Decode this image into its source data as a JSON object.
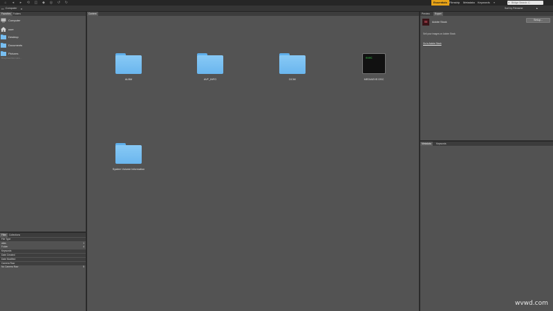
{
  "workspaces": [
    {
      "label": "Essentials",
      "active": true
    },
    {
      "label": "Filmstrip"
    },
    {
      "label": "Metadata"
    },
    {
      "label": "Keywords"
    }
  ],
  "search": {
    "placeholder": "Bridge Search: C"
  },
  "path": {
    "crumb": "Computer",
    "sort_label": "Sort by Filename"
  },
  "left_top_tabs": [
    "Favorites",
    "Folders"
  ],
  "favorites": [
    {
      "label": "Computer",
      "icon": "computer-icon"
    },
    {
      "label": "user",
      "icon": "home-icon"
    },
    {
      "label": "Desktop",
      "icon": "folder-icon"
    },
    {
      "label": "Documents",
      "icon": "folder-icon"
    },
    {
      "label": "Pictures",
      "icon": "folder-icon"
    }
  ],
  "favorites_hint": "Drag Favorites Here...",
  "left_bottom_tabs": [
    "Filter",
    "Collections"
  ],
  "filters": [
    {
      "label": "File Type",
      "header": true
    },
    {
      "label": "alias",
      "count": "1"
    },
    {
      "label": "Folder",
      "count": "4"
    },
    {
      "label": "Keywords",
      "header": true
    },
    {
      "label": "Date Created",
      "header": true
    },
    {
      "label": "Date Modified",
      "header": true
    },
    {
      "label": "Camera Raw",
      "header": true
    },
    {
      "label": "No Camera Raw",
      "count": "5"
    }
  ],
  "content_tab": "Content",
  "items": [
    {
      "label": "ALBM",
      "kind": "folder"
    },
    {
      "label": "AVF_INFO",
      "kind": "folder"
    },
    {
      "label": "DCIM",
      "kind": "folder"
    },
    {
      "label": "MEDIAEXE.DSC",
      "kind": "exec",
      "badge": "exec"
    },
    {
      "label": "System Volume Information",
      "kind": "folder"
    }
  ],
  "right_top_tabs": [
    "Preview",
    "Export"
  ],
  "stock": {
    "logo": "St",
    "title": "Adobe Stock",
    "setup": "Setup...",
    "desc": "Sell your images on Adobe Stock",
    "link": "Go to Adobe Stock"
  },
  "right_bottom_tabs": [
    "Metadata",
    "Keywords"
  ],
  "watermark": "wvwd.com"
}
